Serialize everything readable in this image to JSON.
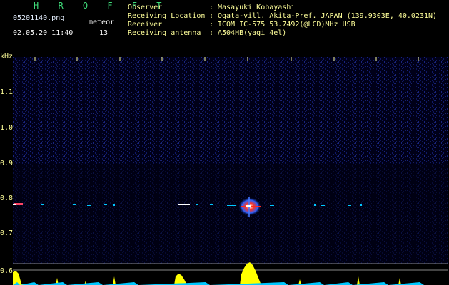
{
  "header": {
    "brand": "H R O F F T",
    "filename": "05201140.png",
    "datetime": "02.05.20 11:40",
    "meteor_label": "meteor",
    "meteor_count": "13"
  },
  "info": [
    {
      "key": "Observer",
      "value": "Masayuki Kobayashi"
    },
    {
      "key": "Receiving Location",
      "value": "Ogata-vill. Akita-Pref. JAPAN (139.9303E, 40.0231N)"
    },
    {
      "key": "Receiver",
      "value": "ICOM IC-575 53.7492(@LCD)MHz USB"
    },
    {
      "key": "Receiving antenna",
      "value": "A504HB(yagi 4el)"
    }
  ],
  "spectrogram": {
    "y_unit": "kHz",
    "x_ticks": [
      "1141",
      "1142",
      "1143",
      "1144",
      "1145",
      "1146",
      "1147",
      "1148",
      "1149",
      "1150"
    ],
    "y_ticks": [
      "1.1",
      "1.0",
      "0.9",
      "0.8",
      "0.7",
      "0.6"
    ],
    "colors": {
      "background": "#000010",
      "noise": "#1e2a8c",
      "signal": "#ff2a1a",
      "trace": "#00c8ff",
      "burst": "#ffff00"
    }
  }
}
